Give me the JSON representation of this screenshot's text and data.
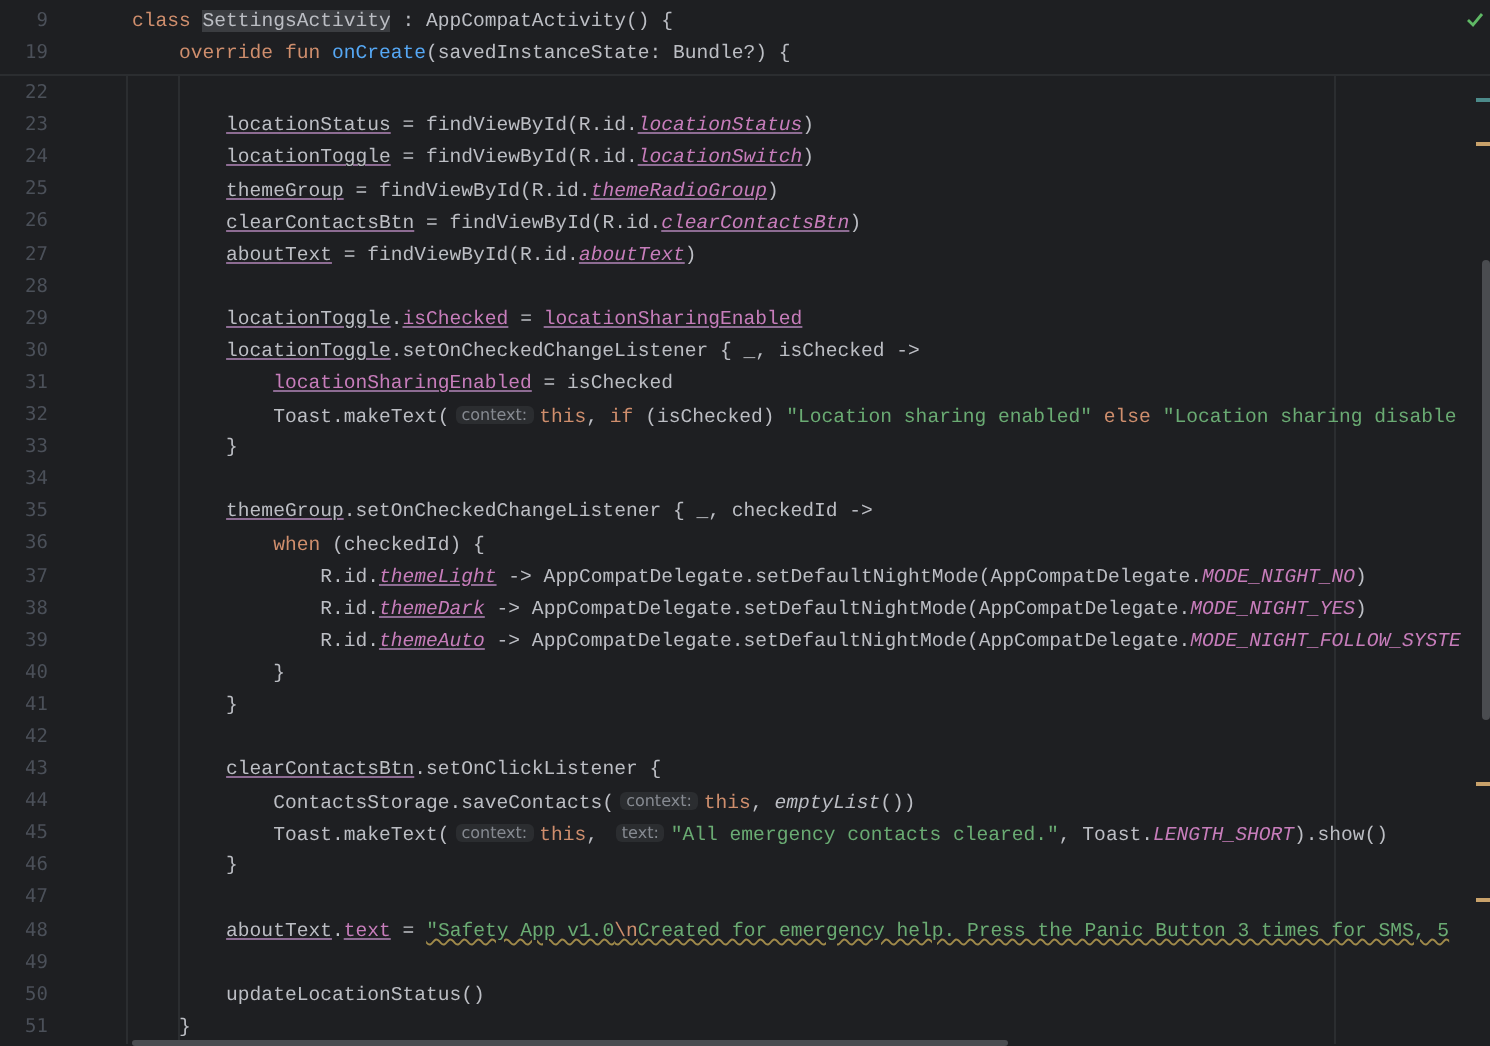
{
  "editor": {
    "sticky_lines": [
      {
        "number": "9",
        "tokens": [
          {
            "text": "class ",
            "kind": "kw"
          },
          {
            "text": "SettingsActivity",
            "kind": "match"
          },
          {
            "text": " : AppCompatActivity() {",
            "kind": "plain"
          }
        ]
      },
      {
        "number": "19",
        "tokens": [
          {
            "text": "    override fun ",
            "kind": "kw"
          },
          {
            "text": "onCreate",
            "kind": "decl"
          },
          {
            "text": "(savedInstanceState: Bundle?) {",
            "kind": "plain"
          }
        ]
      }
    ],
    "lines": [
      {
        "number": "22"
      },
      {
        "number": "23",
        "tokens": [
          {
            "text": "        locationStatus",
            "kind": "prop"
          },
          {
            "text": " = findViewById(R.id.",
            "kind": "plain"
          },
          {
            "text": "locationStatus",
            "kind": "field"
          },
          {
            "text": ")",
            "kind": "plain"
          }
        ]
      },
      {
        "number": "24",
        "tokens": [
          {
            "text": "        locationToggle",
            "kind": "prop"
          },
          {
            "text": " = findViewById(R.id.",
            "kind": "plain"
          },
          {
            "text": "locationSwitch",
            "kind": "field"
          },
          {
            "text": ")",
            "kind": "plain"
          }
        ]
      },
      {
        "number": "25",
        "tokens": [
          {
            "text": "        themeGroup",
            "kind": "prop"
          },
          {
            "text": " = findViewById(R.id.",
            "kind": "plain"
          },
          {
            "text": "themeRadioGroup",
            "kind": "field"
          },
          {
            "text": ")",
            "kind": "plain"
          }
        ]
      },
      {
        "number": "26",
        "tokens": [
          {
            "text": "        clearContactsBtn",
            "kind": "prop"
          },
          {
            "text": " = findViewById(R.id.",
            "kind": "plain"
          },
          {
            "text": "clearContactsBtn",
            "kind": "field"
          },
          {
            "text": ")",
            "kind": "plain"
          }
        ]
      },
      {
        "number": "27",
        "tokens": [
          {
            "text": "        aboutText",
            "kind": "prop"
          },
          {
            "text": " = findViewById(R.id.",
            "kind": "plain"
          },
          {
            "text": "aboutText",
            "kind": "field"
          },
          {
            "text": ")",
            "kind": "plain"
          }
        ]
      },
      {
        "number": "28"
      },
      {
        "number": "29",
        "tokens": [
          {
            "text": "        locationToggle",
            "kind": "prop"
          },
          {
            "text": ".",
            "kind": "plain"
          },
          {
            "text": "isChecked",
            "kind": "member"
          },
          {
            "text": " = ",
            "kind": "plain"
          },
          {
            "text": "locationSharingEnabled",
            "kind": "member"
          }
        ]
      },
      {
        "number": "30",
        "tokens": [
          {
            "text": "        locationToggle",
            "kind": "prop"
          },
          {
            "text": ".setOnCheckedChangeListener { _, isChecked ->",
            "kind": "plain"
          }
        ]
      },
      {
        "number": "31",
        "tokens": [
          {
            "text": "            locationSharingEnabled",
            "kind": "member"
          },
          {
            "text": " = isChecked",
            "kind": "plain"
          }
        ]
      },
      {
        "number": "32",
        "tokens": [
          {
            "text": "            Toast.makeText(",
            "kind": "plain"
          },
          {
            "text": "context:",
            "kind": "hint"
          },
          {
            "text": "this",
            "kind": "kw"
          },
          {
            "text": ", ",
            "kind": "plain"
          },
          {
            "text": "if",
            "kind": "kw"
          },
          {
            "text": " (isChecked) ",
            "kind": "plain"
          },
          {
            "text": "\"Location sharing enabled\"",
            "kind": "string"
          },
          {
            "text": " else ",
            "kind": "kw"
          },
          {
            "text": "\"Location sharing disable",
            "kind": "string"
          }
        ]
      },
      {
        "number": "33",
        "tokens": [
          {
            "text": "        }",
            "kind": "plain"
          }
        ]
      },
      {
        "number": "34"
      },
      {
        "number": "35",
        "tokens": [
          {
            "text": "        themeGroup",
            "kind": "prop"
          },
          {
            "text": ".setOnCheckedChangeListener { _, checkedId ->",
            "kind": "plain"
          }
        ]
      },
      {
        "number": "36",
        "tokens": [
          {
            "text": "            when",
            "kind": "kw"
          },
          {
            "text": " (checkedId) {",
            "kind": "plain"
          }
        ]
      },
      {
        "number": "37",
        "tokens": [
          {
            "text": "                R.id.",
            "kind": "plain"
          },
          {
            "text": "themeLight",
            "kind": "field"
          },
          {
            "text": " -> AppCompatDelegate.setDefaultNightMode(AppCompatDelegate.",
            "kind": "plain"
          },
          {
            "text": "MODE_NIGHT_NO",
            "kind": "const"
          },
          {
            "text": ")",
            "kind": "plain"
          }
        ]
      },
      {
        "number": "38",
        "tokens": [
          {
            "text": "                R.id.",
            "kind": "plain"
          },
          {
            "text": "themeDark",
            "kind": "field"
          },
          {
            "text": " -> AppCompatDelegate.setDefaultNightMode(AppCompatDelegate.",
            "kind": "plain"
          },
          {
            "text": "MODE_NIGHT_YES",
            "kind": "const"
          },
          {
            "text": ")",
            "kind": "plain"
          }
        ]
      },
      {
        "number": "39",
        "tokens": [
          {
            "text": "                R.id.",
            "kind": "plain"
          },
          {
            "text": "themeAuto",
            "kind": "field"
          },
          {
            "text": " -> AppCompatDelegate.setDefaultNightMode(AppCompatDelegate.",
            "kind": "plain"
          },
          {
            "text": "MODE_NIGHT_FOLLOW_SYSTE",
            "kind": "const"
          }
        ]
      },
      {
        "number": "40",
        "tokens": [
          {
            "text": "            }",
            "kind": "plain"
          }
        ]
      },
      {
        "number": "41",
        "tokens": [
          {
            "text": "        }",
            "kind": "plain"
          }
        ]
      },
      {
        "number": "42"
      },
      {
        "number": "43",
        "tokens": [
          {
            "text": "        clearContactsBtn",
            "kind": "prop"
          },
          {
            "text": ".setOnClickListener {",
            "kind": "plain"
          }
        ]
      },
      {
        "number": "44",
        "tokens": [
          {
            "text": "            ContactsStorage.saveContacts(",
            "kind": "plain"
          },
          {
            "text": "context:",
            "kind": "hint"
          },
          {
            "text": "this",
            "kind": "kw"
          },
          {
            "text": ", ",
            "kind": "plain"
          },
          {
            "text": "emptyList",
            "kind": "italic"
          },
          {
            "text": "())",
            "kind": "plain"
          }
        ]
      },
      {
        "number": "45",
        "tokens": [
          {
            "text": "            Toast.makeText(",
            "kind": "plain"
          },
          {
            "text": "context:",
            "kind": "hint"
          },
          {
            "text": "this",
            "kind": "kw"
          },
          {
            "text": ", ",
            "kind": "plain"
          },
          {
            "text": "text:",
            "kind": "hint"
          },
          {
            "text": "\"All emergency contacts cleared.\"",
            "kind": "string"
          },
          {
            "text": ", Toast.",
            "kind": "plain"
          },
          {
            "text": "LENGTH_SHORT",
            "kind": "const"
          },
          {
            "text": ").show()",
            "kind": "plain"
          }
        ]
      },
      {
        "number": "46",
        "tokens": [
          {
            "text": "        }",
            "kind": "plain"
          }
        ]
      },
      {
        "number": "47"
      },
      {
        "number": "48",
        "tokens": [
          {
            "text": "        aboutText",
            "kind": "prop"
          },
          {
            "text": ".",
            "kind": "plain"
          },
          {
            "text": "text",
            "kind": "member"
          },
          {
            "text": " = ",
            "kind": "plain"
          },
          {
            "text": "\"Safety App v1.0",
            "kind": "string-warn"
          },
          {
            "text": "\\n",
            "kind": "escape"
          },
          {
            "text": "Created for emergency help. Press the Panic Button 3 times for SMS, 5",
            "kind": "string-warn"
          }
        ]
      },
      {
        "number": "49"
      },
      {
        "number": "50",
        "tokens": [
          {
            "text": "        updateLocationStatus()",
            "kind": "plain"
          }
        ]
      },
      {
        "number": "51",
        "tokens": [
          {
            "text": "    }",
            "kind": "plain"
          }
        ]
      }
    ]
  }
}
